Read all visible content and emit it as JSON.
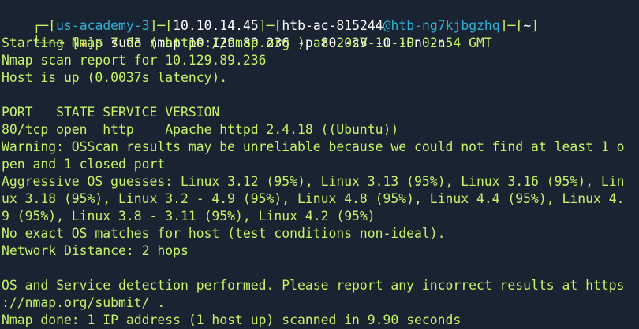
{
  "prompt": {
    "corner_top": "┌─",
    "bracket_open_1": "[",
    "user": "us-academy-3",
    "bracket_close_1": "]",
    "sep1": "─",
    "bracket_open_2": "[",
    "ip": "10.10.14.45",
    "bracket_close_2": "]",
    "sep2": "─",
    "bracket_open_3": "[",
    "host_user": "htb-ac-815244",
    "at": "@",
    "host": "htb-ng7kjbgzhq",
    "bracket_close_3": "]",
    "sep3": "─",
    "bracket_open_4": "[",
    "dir": "~",
    "bracket_close_4": "]",
    "corner_bottom": "└──╼ ",
    "star_open": "[",
    "star": "★",
    "star_close": "]",
    "dollar": "$ ",
    "command": "sudo nmap 10.129.89.236 -p 80 -sV -O -Pn -n"
  },
  "output": [
    "Starting Nmap 7.93 ( https://nmap.org ) at 2023-11-10 02:54 GMT",
    "Nmap scan report for 10.129.89.236",
    "Host is up (0.0037s latency).",
    "",
    "PORT   STATE SERVICE VERSION",
    "80/tcp open  http    Apache httpd 2.4.18 ((Ubuntu))",
    "Warning: OSScan results may be unreliable because we could not find at least 1 o",
    "pen and 1 closed port",
    "Aggressive OS guesses: Linux 3.12 (95%), Linux 3.13 (95%), Linux 3.16 (95%), Lin",
    "ux 3.18 (95%), Linux 3.2 - 4.9 (95%), Linux 4.8 (95%), Linux 4.4 (95%), Linux 4.",
    "9 (95%), Linux 3.8 - 3.11 (95%), Linux 4.2 (95%)",
    "No exact OS matches for host (test conditions non-ideal).",
    "Network Distance: 2 hops",
    "",
    "OS and Service detection performed. Please report any incorrect results at https",
    "://nmap.org/submit/ .",
    "Nmap done: 1 IP address (1 host up) scanned in 9.90 seconds"
  ]
}
